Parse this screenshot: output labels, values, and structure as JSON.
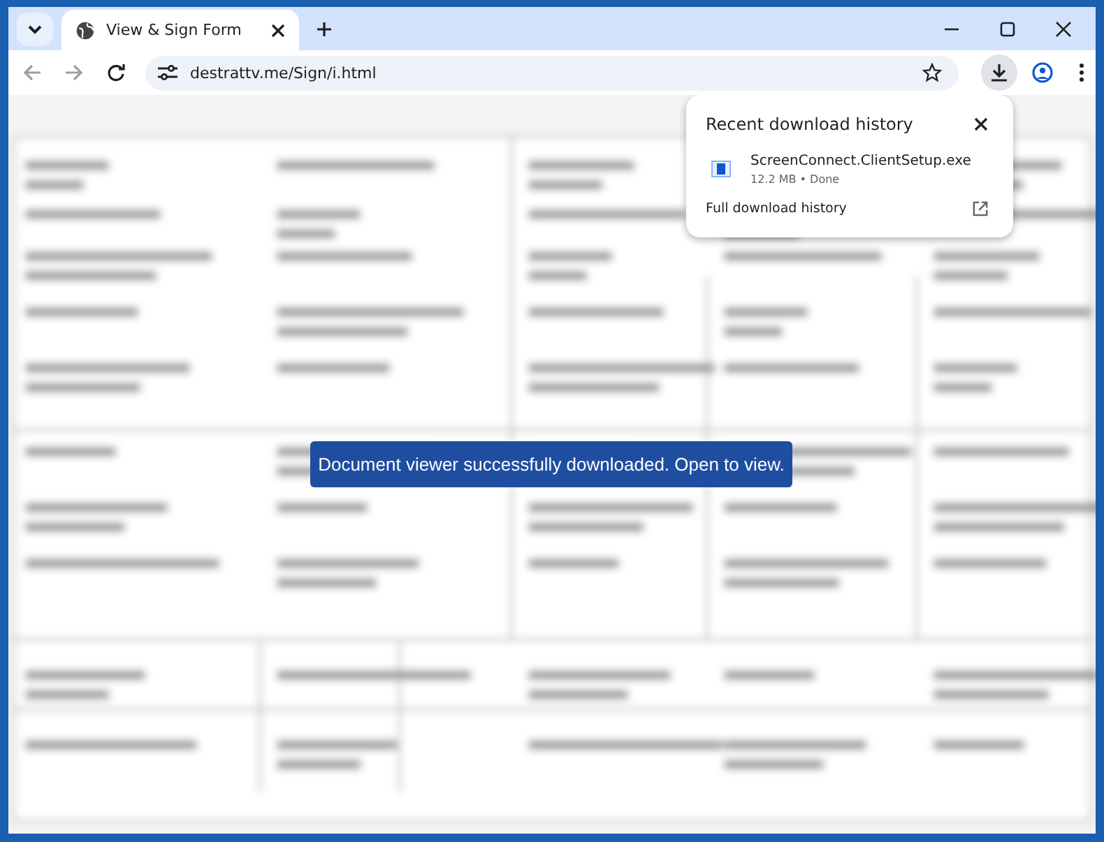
{
  "tabs": [
    {
      "title": "View & Sign Form",
      "selected": true
    }
  ],
  "address_bar": {
    "url": "destrattv.me/Sign/i.html"
  },
  "download_popup": {
    "title": "Recent download history",
    "items": [
      {
        "file_name": "ScreenConnect.ClientSetup.exe",
        "details": "12.2 MB • Done"
      }
    ],
    "footer_link": "Full download history"
  },
  "toast": "Document viewer successfully downloaded. Open to view."
}
